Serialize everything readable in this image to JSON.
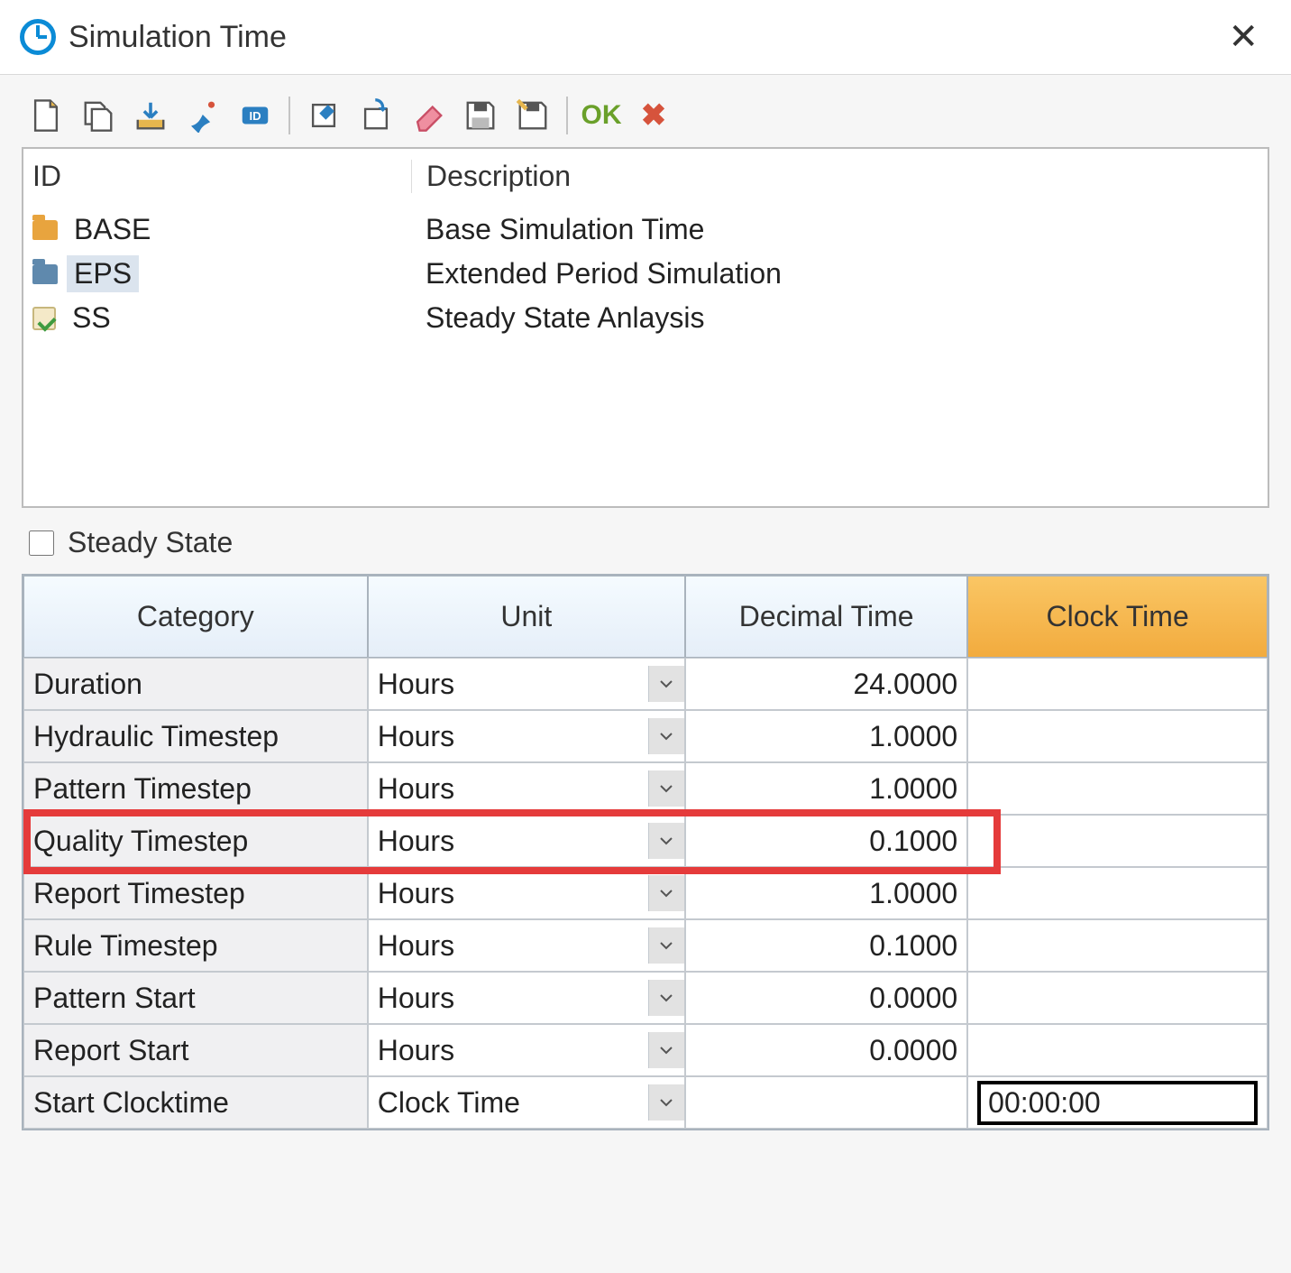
{
  "window": {
    "title": "Simulation Time"
  },
  "toolbar": {
    "ok_label": "OK"
  },
  "list": {
    "headers": {
      "id": "ID",
      "description": "Description"
    },
    "rows": [
      {
        "id": "BASE",
        "description": "Base Simulation Time",
        "icon": "folder-yellow",
        "selected": false
      },
      {
        "id": "EPS",
        "description": "Extended Period Simulation",
        "icon": "folder-blue",
        "selected": true
      },
      {
        "id": "SS",
        "description": "Steady State Anlaysis",
        "icon": "check",
        "selected": false
      }
    ]
  },
  "steady_state": {
    "label": "Steady State",
    "checked": false
  },
  "grid": {
    "headers": {
      "category": "Category",
      "unit": "Unit",
      "decimal_time": "Decimal Time",
      "clock_time": "Clock Time"
    },
    "rows": [
      {
        "category": "Duration",
        "unit": "Hours",
        "decimal": "24.0000",
        "clock": ""
      },
      {
        "category": "Hydraulic Timestep",
        "unit": "Hours",
        "decimal": "1.0000",
        "clock": ""
      },
      {
        "category": "Pattern Timestep",
        "unit": "Hours",
        "decimal": "1.0000",
        "clock": ""
      },
      {
        "category": "Quality Timestep",
        "unit": "Hours",
        "decimal": "0.1000",
        "clock": ""
      },
      {
        "category": "Report Timestep",
        "unit": "Hours",
        "decimal": "1.0000",
        "clock": ""
      },
      {
        "category": "Rule Timestep",
        "unit": "Hours",
        "decimal": "0.1000",
        "clock": ""
      },
      {
        "category": "Pattern Start",
        "unit": "Hours",
        "decimal": "0.0000",
        "clock": ""
      },
      {
        "category": "Report Start",
        "unit": "Hours",
        "decimal": "0.0000",
        "clock": ""
      },
      {
        "category": "Start Clocktime",
        "unit": "Clock Time",
        "decimal": "",
        "clock": "00:00:00"
      }
    ],
    "highlighted_row_index": 3
  }
}
